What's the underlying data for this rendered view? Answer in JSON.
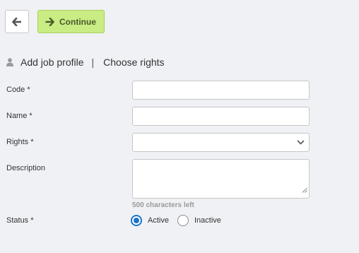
{
  "toolbar": {
    "back_icon": "arrow-left-icon",
    "continue_icon": "arrow-right-icon",
    "continue_label": "Continue"
  },
  "breadcrumb": {
    "icon": "user-icon",
    "step1": "Add job profile",
    "separator": "|",
    "step2": "Choose rights"
  },
  "form": {
    "code": {
      "label": "Code *",
      "value": ""
    },
    "name": {
      "label": "Name *",
      "value": ""
    },
    "rights": {
      "label": "Rights *",
      "selected": ""
    },
    "description": {
      "label": "Description",
      "value": "",
      "char_count": "500 characters left"
    },
    "status": {
      "label": "Status *",
      "options": [
        "Active",
        "Inactive"
      ],
      "selected": "Active"
    }
  },
  "colors": {
    "background": "#f0f1f5",
    "continue_bg": "#c9ec84",
    "radio_accent": "#1a73c8"
  }
}
